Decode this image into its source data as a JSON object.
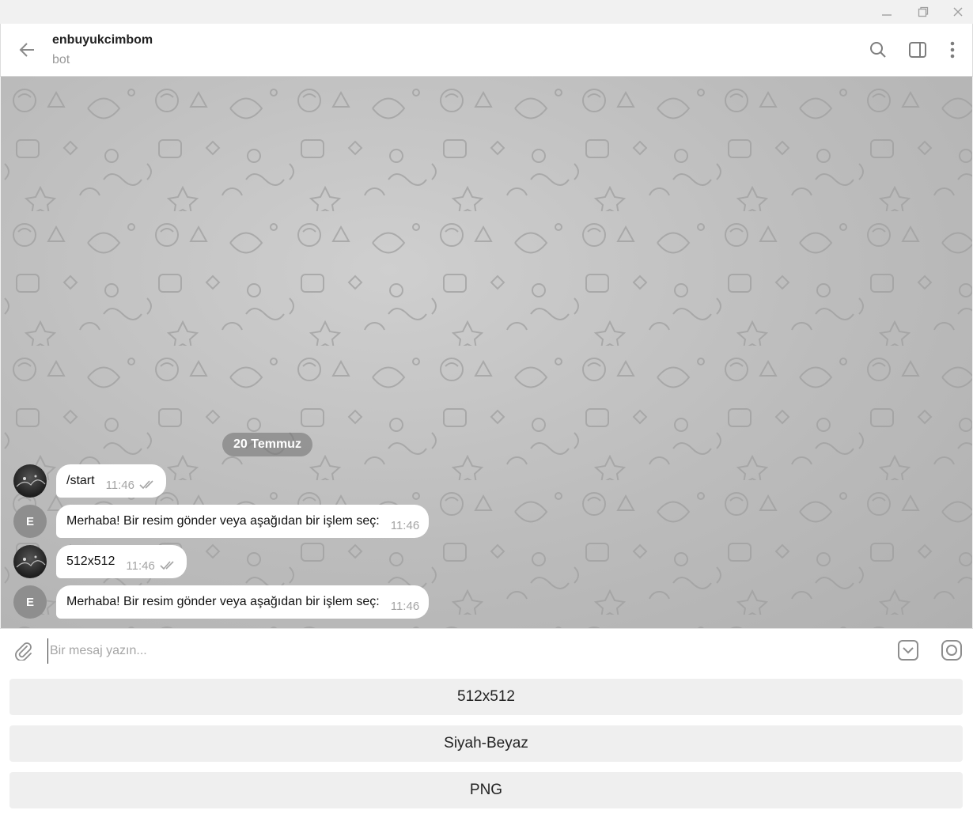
{
  "window": {
    "minimize_icon": "minimize-icon",
    "restore_icon": "restore-icon",
    "close_icon": "close-icon"
  },
  "header": {
    "title": "enbuyukcimbom",
    "subtitle": "bot",
    "icons": [
      "back-arrow-icon",
      "search-icon",
      "sidebar-toggle-icon",
      "more-vertical-icon"
    ]
  },
  "chat": {
    "date_label": "20 Temmuz",
    "messages": [
      {
        "sender": "user",
        "avatar_letter": "",
        "text": "/start",
        "time": "11:46",
        "read": true
      },
      {
        "sender": "bot",
        "avatar_letter": "E",
        "text": "Merhaba! Bir resim gönder veya aşağıdan bir işlem seç:",
        "time": "11:46",
        "read": false
      },
      {
        "sender": "user",
        "avatar_letter": "",
        "text": "512x512",
        "time": "11:46",
        "read": true
      },
      {
        "sender": "bot",
        "avatar_letter": "E",
        "text": "Merhaba! Bir resim gönder veya aşağıdan bir işlem seç:",
        "time": "11:46",
        "read": false
      }
    ]
  },
  "composer": {
    "placeholder": "Bir mesaj yazın...",
    "value": ""
  },
  "keyboard": {
    "buttons": [
      "512x512",
      "Siyah-Beyaz",
      "PNG"
    ]
  },
  "colors": {
    "accent": "#222222",
    "chat_bg": "#bfbfbf",
    "bubble": "#ffffff",
    "button_bg": "#efefef"
  }
}
